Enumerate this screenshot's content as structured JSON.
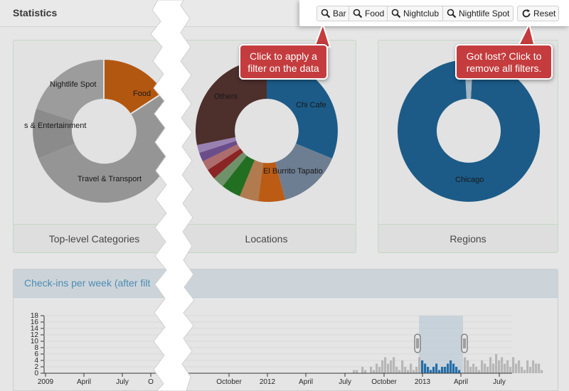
{
  "header": {
    "title": "Statistics"
  },
  "filters": {
    "buttons": [
      {
        "label": "Bar",
        "icon": "search-icon"
      },
      {
        "label": "Food",
        "icon": "search-icon"
      },
      {
        "label": "Nightclub",
        "icon": "search-icon"
      },
      {
        "label": "Nightlife Spot",
        "icon": "search-icon"
      }
    ],
    "reset_label": "Reset",
    "reset_icon": "refresh-icon"
  },
  "tooltips": {
    "filter_line1": "Click to apply a",
    "filter_line2": "filter on the data",
    "reset_line1": "Got lost? Click to",
    "reset_line2": "remove all filters."
  },
  "panels": {
    "categories": {
      "label": "Top-level Categories",
      "slices": [
        {
          "name": "Nightlife Spot",
          "color": "#9a9a9a"
        },
        {
          "name": "Food",
          "color": "#b85508"
        },
        {
          "name": "s & Entertainment",
          "color": "#8c8c8c"
        },
        {
          "name": "Travel & Transport",
          "color": "#959595"
        }
      ]
    },
    "locations": {
      "label": "Locations",
      "slices": [
        {
          "name": "Chi Cafe",
          "color": "#155a8a"
        },
        {
          "name": "El Burrito Tapatio",
          "color": "#6d7f95"
        },
        {
          "name": "Others",
          "color": "#4a2a26"
        }
      ]
    },
    "regions": {
      "label": "Regions",
      "slices": [
        {
          "name": "Chicago",
          "color": "#155a8a"
        }
      ]
    }
  },
  "checkins": {
    "title": "Check-ins per week (after filt",
    "y_ticks": [
      "18",
      "16",
      "14",
      "12",
      "10",
      "8",
      "6",
      "4",
      "2",
      "0"
    ],
    "x_ticks_left": [
      "2009",
      "April",
      "July",
      "O"
    ],
    "x_ticks_right": [
      "October",
      "2012",
      "April",
      "July",
      "October",
      "2013",
      "April",
      "July"
    ],
    "bar_color": "#bdbdbd",
    "selected_bar_color": "#1f6fad",
    "values": [
      1,
      1,
      0,
      2,
      1,
      0,
      2,
      1,
      3,
      2,
      4,
      5,
      3,
      4,
      5,
      2,
      1,
      4,
      2,
      1,
      3,
      1,
      2,
      5,
      4,
      3,
      2,
      1,
      2,
      3,
      1,
      2,
      2,
      3,
      4,
      3,
      2,
      1,
      0,
      5,
      4,
      2,
      3,
      2,
      1,
      4,
      3,
      2,
      5,
      3,
      6,
      4,
      5,
      3,
      4,
      2,
      5,
      3,
      4,
      2,
      1,
      4,
      2,
      4,
      3,
      3,
      1
    ]
  }
}
